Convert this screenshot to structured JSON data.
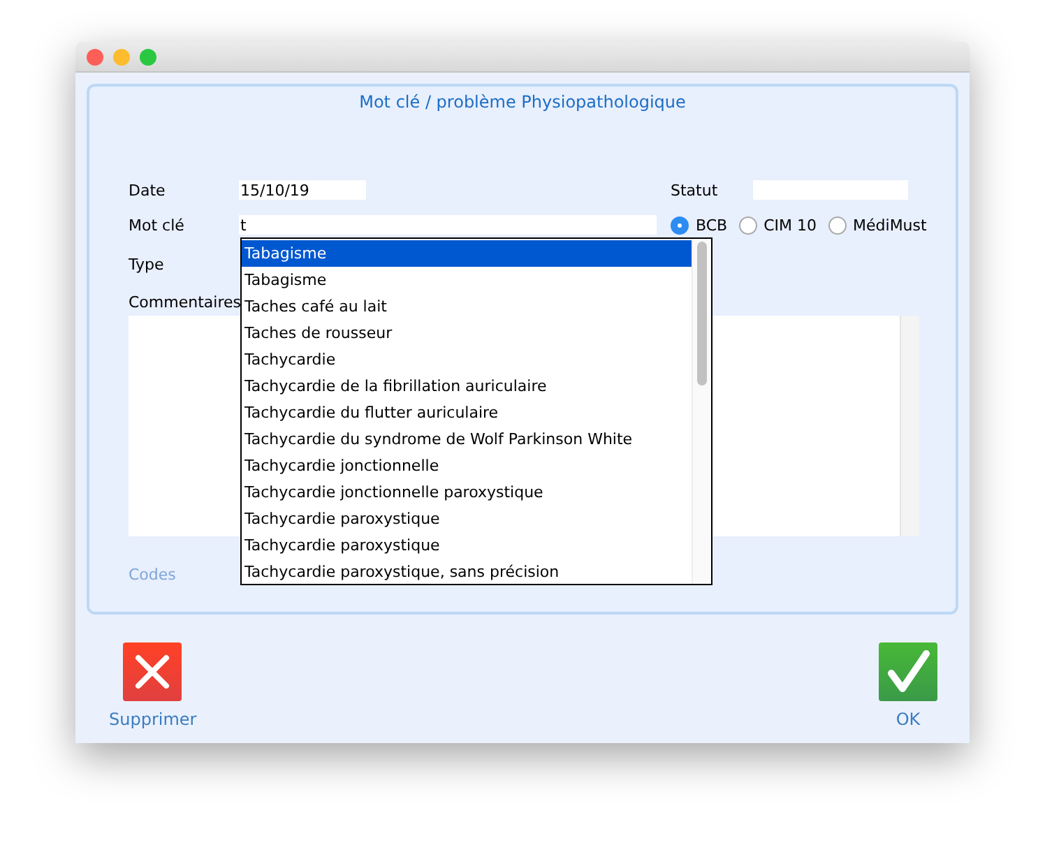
{
  "title": "Mot clé / problème Physiopathologique",
  "date": {
    "label": "Date",
    "value": "15/10/19"
  },
  "statut": {
    "label": "Statut"
  },
  "mot_cle": {
    "label": "Mot clé",
    "value": "t"
  },
  "sources": [
    {
      "label": "BCB",
      "selected": true
    },
    {
      "label": "CIM 10",
      "selected": false
    },
    {
      "label": "MédiMust",
      "selected": false
    }
  ],
  "type": {
    "label": "Type"
  },
  "commentaires": {
    "label": "Commentaires"
  },
  "codes": {
    "label": "Codes",
    "disabled": true
  },
  "suggestions": [
    {
      "label": "Tabagisme",
      "selected": true
    },
    {
      "label": "Tabagisme",
      "selected": false
    },
    {
      "label": "Taches café au lait",
      "selected": false
    },
    {
      "label": "Taches de rousseur",
      "selected": false
    },
    {
      "label": "Tachycardie",
      "selected": false
    },
    {
      "label": "Tachycardie de la fibrillation auriculaire",
      "selected": false
    },
    {
      "label": "Tachycardie du flutter auriculaire",
      "selected": false
    },
    {
      "label": "Tachycardie du syndrome de Wolf Parkinson White",
      "selected": false
    },
    {
      "label": "Tachycardie jonctionnelle",
      "selected": false
    },
    {
      "label": "Tachycardie jonctionnelle paroxystique",
      "selected": false
    },
    {
      "label": "Tachycardie paroxystique",
      "selected": false
    },
    {
      "label": "Tachycardie paroxystique",
      "selected": false
    },
    {
      "label": "Tachycardie paroxystique, sans précision",
      "selected": false
    }
  ],
  "buttons": [
    {
      "label": "Supprimer",
      "kind": "delete"
    },
    {
      "label": "OK",
      "kind": "ok"
    }
  ]
}
